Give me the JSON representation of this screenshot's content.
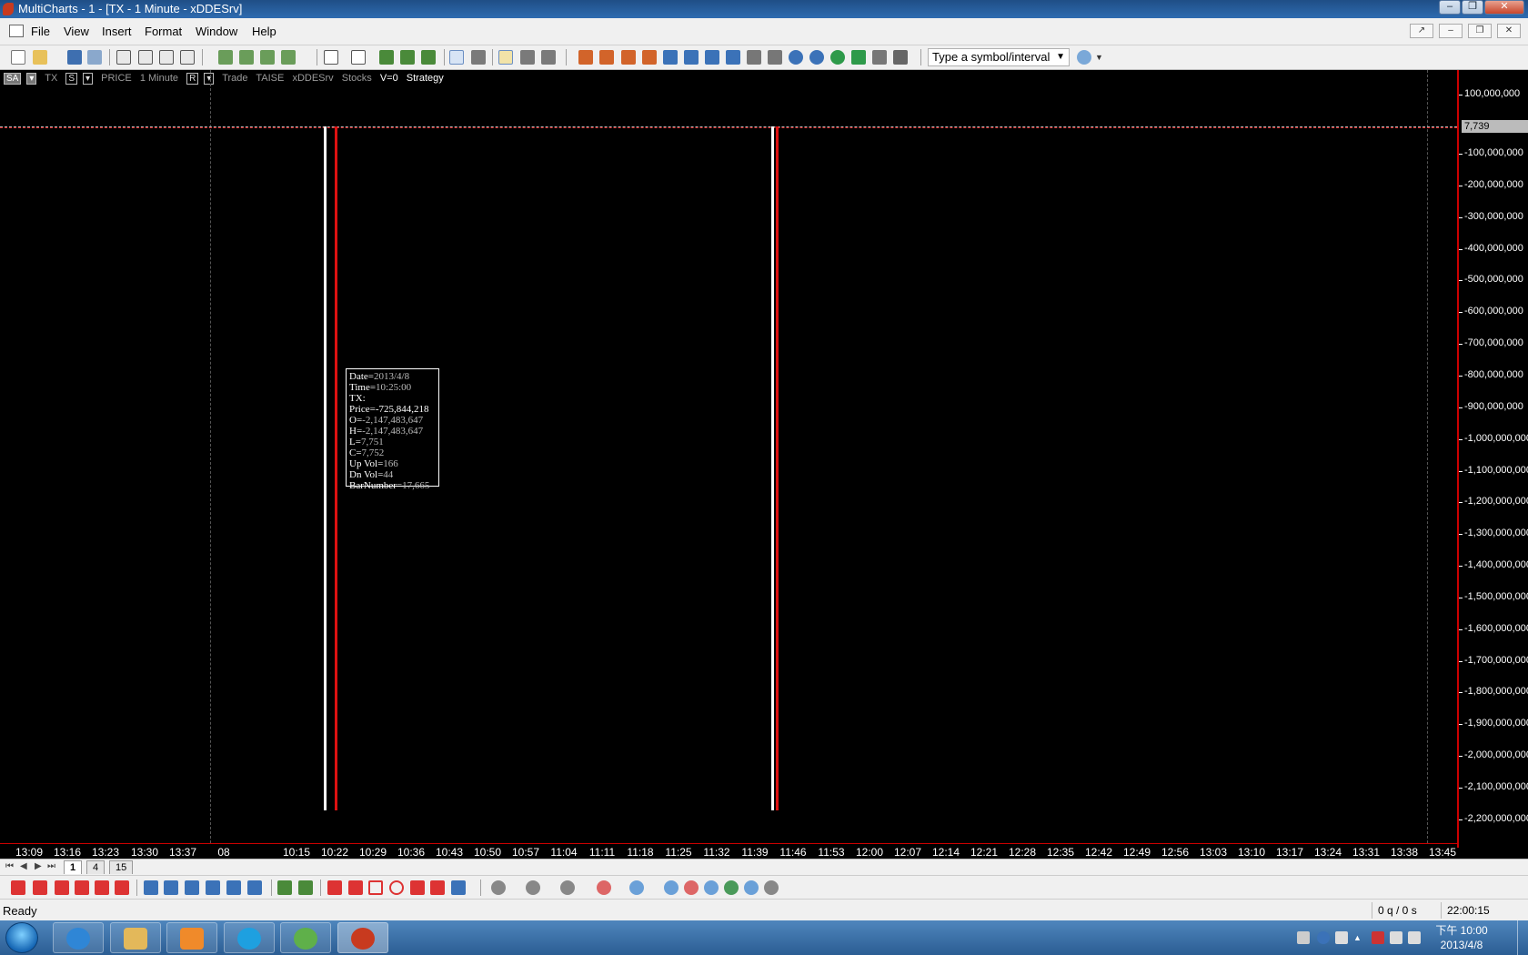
{
  "window": {
    "title": "MultiCharts - 1 - [TX - 1 Minute - xDDESrv]"
  },
  "menu": {
    "items": [
      "File",
      "View",
      "Insert",
      "Format",
      "Window",
      "Help"
    ]
  },
  "toolbar": {
    "symbol_placeholder": "Type a symbol/interval"
  },
  "chart": {
    "status": {
      "sa": "SA",
      "symbol": "TX",
      "s_box": "S",
      "field": "PRICE",
      "interval": "1 Minute",
      "r_box": "R",
      "data_type": "Trade",
      "exchange": "TAISE",
      "datafeed": "xDDESrv",
      "category": "Stocks",
      "volume": "V=0",
      "strategy": "Strategy"
    },
    "price_axis": {
      "labels": [
        "100,000,000",
        "-100,000,000",
        "-200,000,000",
        "-300,000,000",
        "-400,000,000",
        "-500,000,000",
        "-600,000,000",
        "-700,000,000",
        "-800,000,000",
        "-900,000,000",
        "-1,000,000,000",
        "-1,100,000,000",
        "-1,200,000,000",
        "-1,300,000,000",
        "-1,400,000,000",
        "-1,500,000,000",
        "-1,600,000,000",
        "-1,700,000,000",
        "-1,800,000,000",
        "-1,900,000,000",
        "-2,000,000,000",
        "-2,100,000,000",
        "-2,200,000,000"
      ],
      "current_price": "7,739"
    },
    "time_axis": {
      "labels": [
        "13:09",
        "13:16",
        "13:23",
        "13:30",
        "13:37",
        "08",
        "10:15",
        "10:22",
        "10:29",
        "10:36",
        "10:43",
        "10:50",
        "10:57",
        "11:04",
        "11:11",
        "11:18",
        "11:25",
        "11:32",
        "11:39",
        "11:46",
        "11:53",
        "12:00",
        "12:07",
        "12:14",
        "12:21",
        "12:28",
        "12:35",
        "12:42",
        "12:49",
        "12:56",
        "13:03",
        "13:10",
        "13:17",
        "13:24",
        "13:31",
        "13:38",
        "13:45"
      ]
    },
    "data_window": {
      "rows": [
        {
          "k": "Date=",
          "v": "2013/4/8"
        },
        {
          "k": "Time=",
          "v": "10:25:00"
        },
        {
          "k": "TX:",
          "v": ""
        },
        {
          "k": "Price=",
          "v": "-725,844,218"
        },
        {
          "k": "O=",
          "v": "-2,147,483,647"
        },
        {
          "k": "H=",
          "v": "-2,147,483,647"
        },
        {
          "k": "L=",
          "v": "7,751"
        },
        {
          "k": "C=",
          "v": "7,752"
        },
        {
          "k": "Up Vol=",
          "v": "166"
        },
        {
          "k": "Dn Vol=",
          "v": "44"
        },
        {
          "k": "BarNumber=",
          "v": "17,665"
        }
      ]
    }
  },
  "tabs": {
    "items": [
      "1",
      "4",
      "15"
    ],
    "active": "1"
  },
  "statusbar": {
    "ready": "Ready",
    "queue": "0 q / 0 s",
    "time": "22:00:15"
  },
  "taskbar": {
    "clock_time": "下午 10:00",
    "clock_date": "2013/4/8"
  },
  "colors": {
    "accent_red": "#dd1111",
    "bar_white": "#ffffff",
    "background": "#000000"
  }
}
